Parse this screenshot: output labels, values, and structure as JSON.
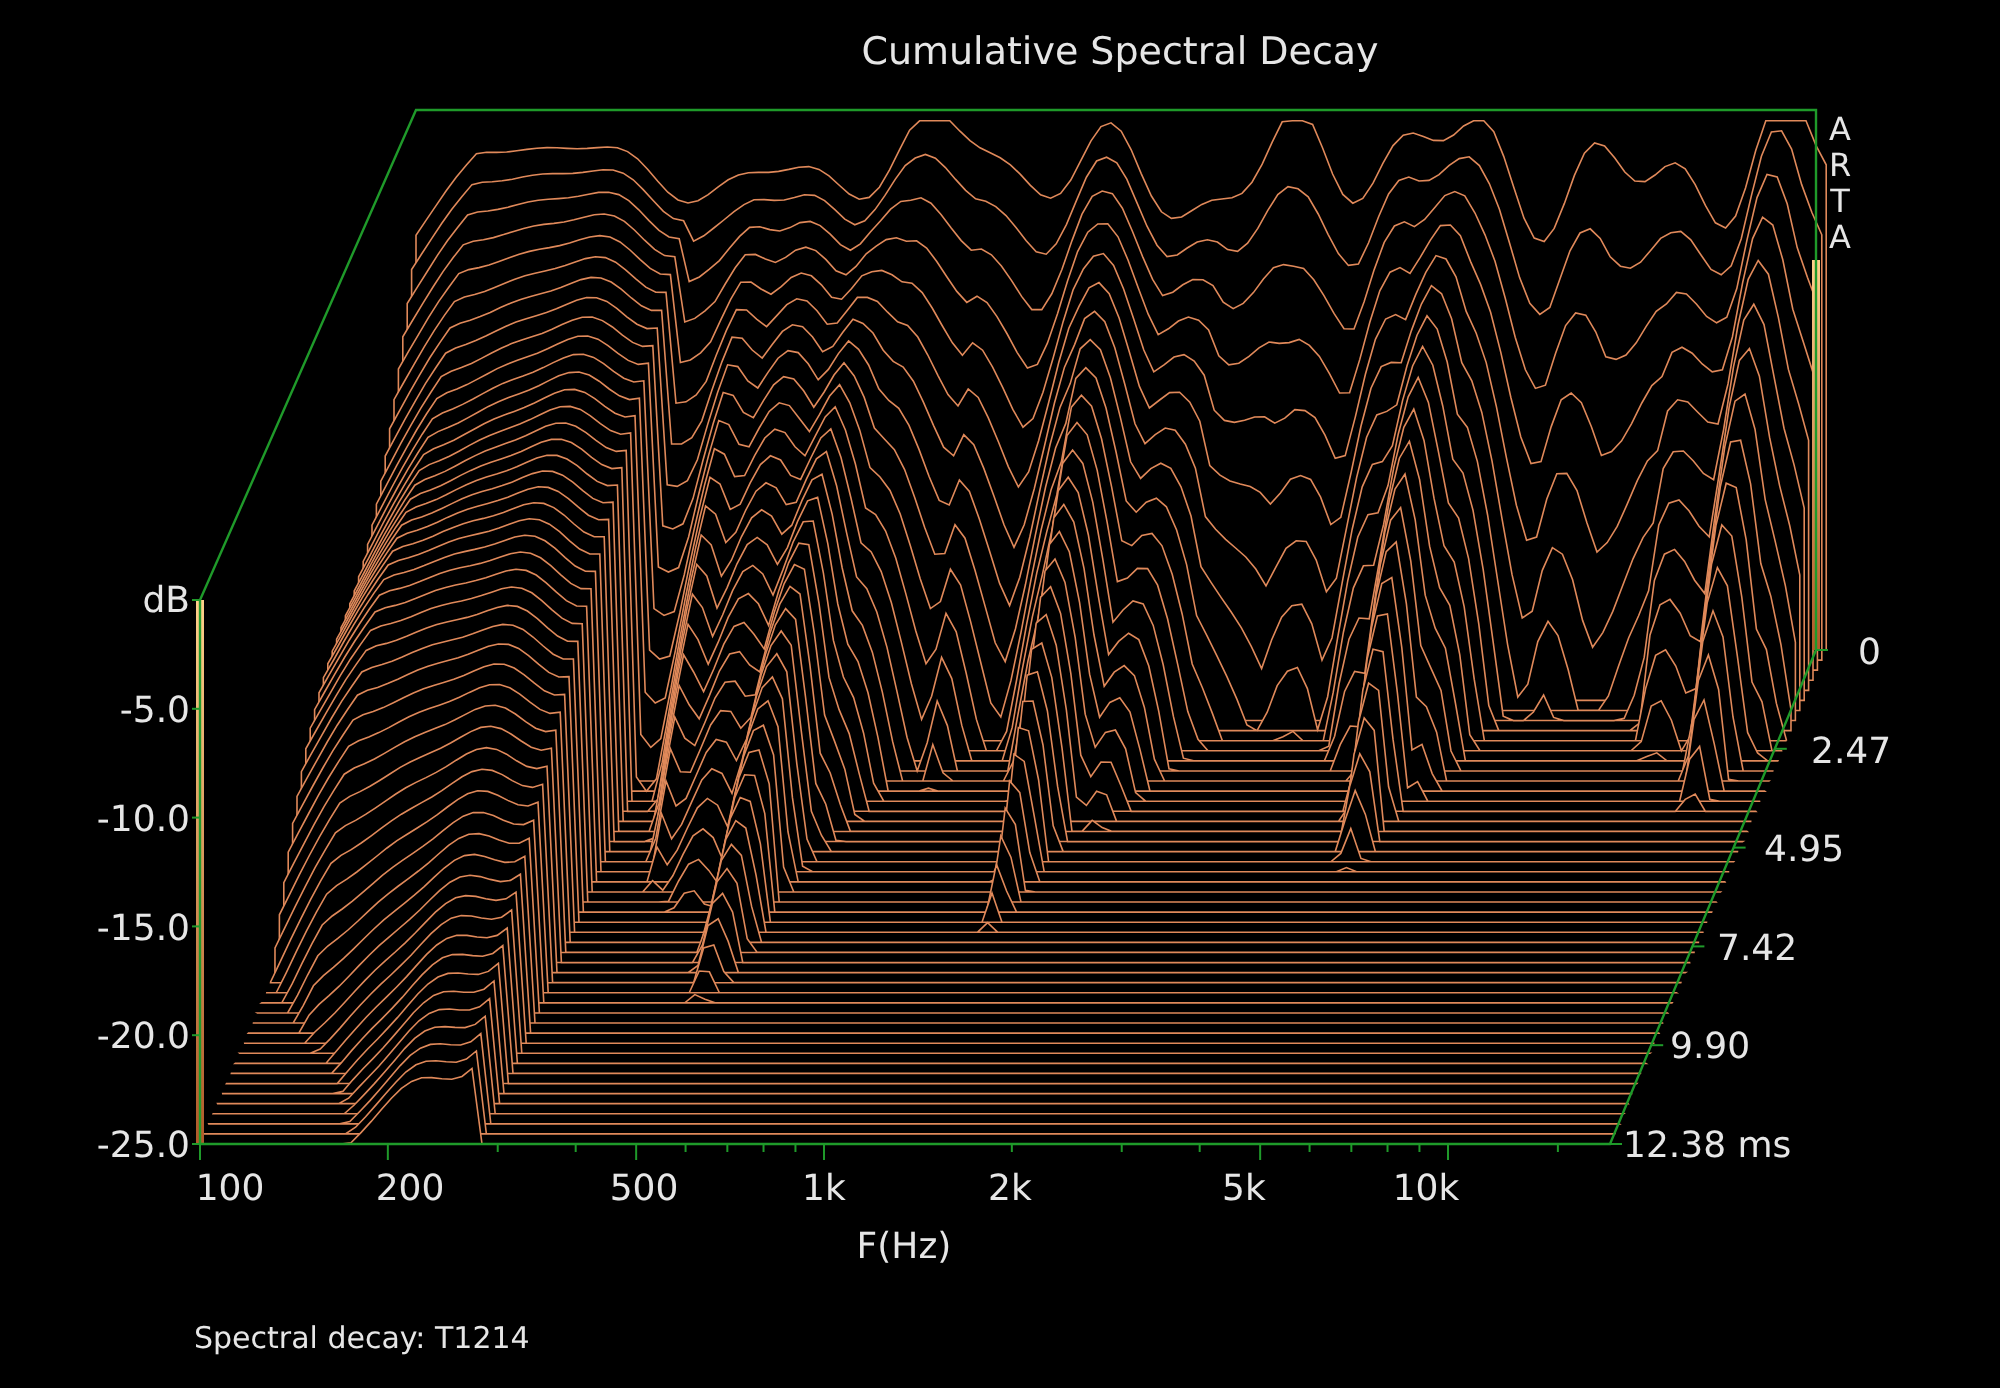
{
  "title": "Cumulative Spectral Decay",
  "chart": {
    "y_label": "dB",
    "y_ticks": [
      "-5.0",
      "-10.0",
      "-15.0",
      "-20.0",
      "-25.0"
    ],
    "x_ticks": [
      "100",
      "200",
      "500",
      "1k",
      "2k",
      "5k",
      "10k"
    ],
    "x_label": "F(Hz)",
    "time_ticks": [
      "0",
      "2.47",
      "4.95",
      "7.42",
      "9.90",
      "12.38 ms"
    ],
    "brand_letters": [
      "A",
      "R",
      "T",
      "A"
    ]
  },
  "footer": "Spectral decay: T1214"
}
